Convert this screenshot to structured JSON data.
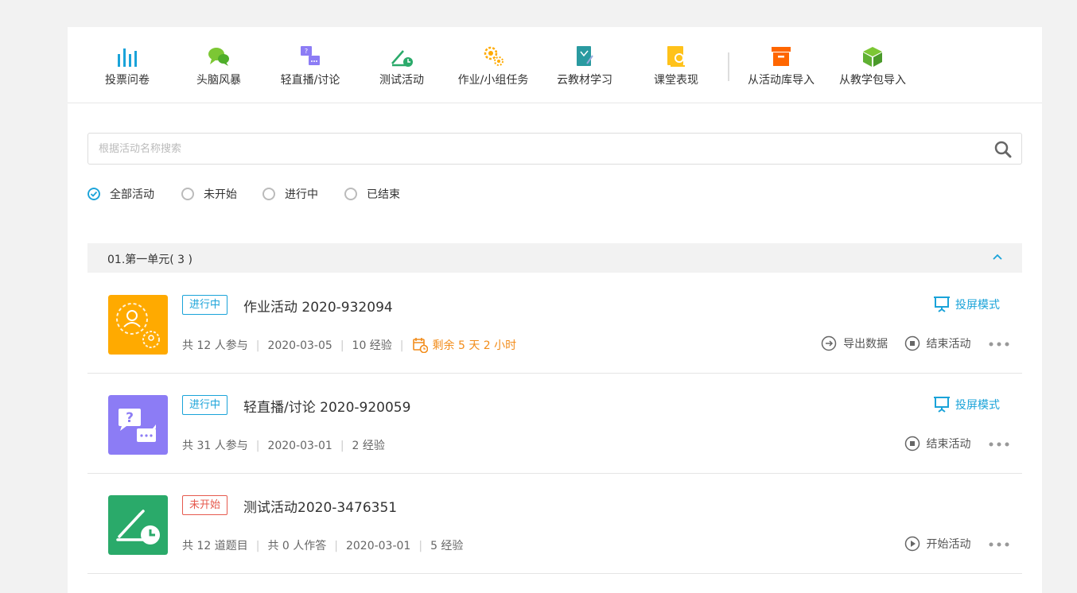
{
  "toolbar": {
    "items": [
      {
        "label": "投票问卷",
        "icon": "vote-icon"
      },
      {
        "label": "头脑风暴",
        "icon": "brainstorm-icon"
      },
      {
        "label": "轻直播/讨论",
        "icon": "live-discussion-icon"
      },
      {
        "label": "测试活动",
        "icon": "test-icon"
      },
      {
        "label": "作业/小组任务",
        "icon": "homework-icon"
      },
      {
        "label": "云教材学习",
        "icon": "cloud-textbook-icon"
      },
      {
        "label": "课堂表现",
        "icon": "class-performance-icon"
      },
      {
        "label": "从活动库导入",
        "icon": "activity-library-icon"
      },
      {
        "label": "从教学包导入",
        "icon": "teaching-package-icon"
      }
    ]
  },
  "search": {
    "placeholder": "根据活动名称搜索",
    "value": ""
  },
  "filters": [
    {
      "label": "全部活动",
      "checked": true
    },
    {
      "label": "未开始",
      "checked": false
    },
    {
      "label": "进行中",
      "checked": false
    },
    {
      "label": "已结束",
      "checked": false
    }
  ],
  "unit": {
    "title": "01.第一单元( 3 )",
    "expanded": true
  },
  "activities": [
    {
      "status": "进行中",
      "title": "作业活动 2020-932094",
      "meta": [
        "共 12 人参与",
        "2020-03-05",
        "10 经验"
      ],
      "remaining": "剩余 5 天 2 小时",
      "projection": "投屏模式",
      "export": "导出数据",
      "action": "结束活动"
    },
    {
      "status": "进行中",
      "title": "轻直播/讨论 2020-920059",
      "meta": [
        "共 31 人参与",
        "2020-03-01",
        "2 经验"
      ],
      "projection": "投屏模式",
      "action": "结束活动"
    },
    {
      "status": "未开始",
      "title": "测试活动2020-3476351",
      "meta": [
        "共 12 道题目",
        "共 0 人作答",
        "2020-03-01",
        "5 经验"
      ],
      "action": "开始活动"
    }
  ],
  "colors": {
    "accent": "#1aa3d9",
    "warning": "#f28c1a",
    "danger": "#e65a4e",
    "homework": "#ffaa00",
    "live": "#8c7cf5",
    "test": "#2aaa6a"
  }
}
